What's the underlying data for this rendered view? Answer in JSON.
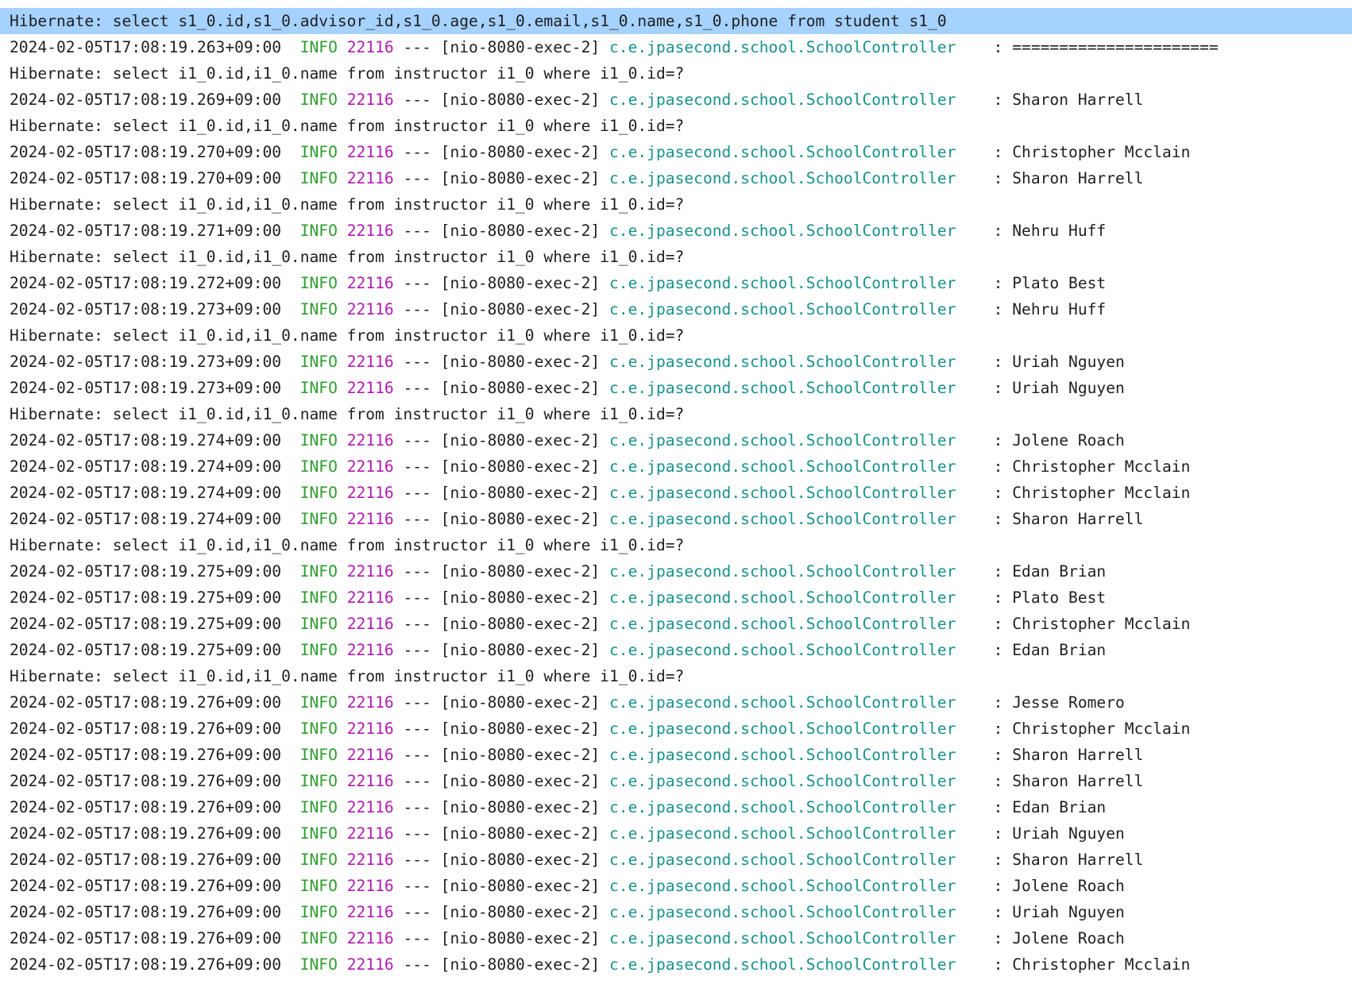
{
  "colors": {
    "selection": "#a6d2ff",
    "level_info": "#2e9e2e",
    "pid": "#b21ab2",
    "logger": "#17928a",
    "text": "#1f1f1f"
  },
  "log_lines": [
    {
      "type": "sql",
      "selected": true,
      "text": "Hibernate: select s1_0.id,s1_0.advisor_id,s1_0.age,s1_0.email,s1_0.name,s1_0.phone from student s1_0"
    },
    {
      "type": "log",
      "ts": "2024-02-05T17:08:19.263+09:00",
      "level": "INFO",
      "pid": "22116",
      "sep": "---",
      "thread": "[nio-8080-exec-2]",
      "logger": "c.e.jpasecond.school.SchoolController",
      "message": ": ======================"
    },
    {
      "type": "sql",
      "text": "Hibernate: select i1_0.id,i1_0.name from instructor i1_0 where i1_0.id=?"
    },
    {
      "type": "log",
      "ts": "2024-02-05T17:08:19.269+09:00",
      "level": "INFO",
      "pid": "22116",
      "sep": "---",
      "thread": "[nio-8080-exec-2]",
      "logger": "c.e.jpasecond.school.SchoolController",
      "message": ": Sharon Harrell"
    },
    {
      "type": "sql",
      "text": "Hibernate: select i1_0.id,i1_0.name from instructor i1_0 where i1_0.id=?"
    },
    {
      "type": "log",
      "ts": "2024-02-05T17:08:19.270+09:00",
      "level": "INFO",
      "pid": "22116",
      "sep": "---",
      "thread": "[nio-8080-exec-2]",
      "logger": "c.e.jpasecond.school.SchoolController",
      "message": ": Christopher Mcclain"
    },
    {
      "type": "log",
      "ts": "2024-02-05T17:08:19.270+09:00",
      "level": "INFO",
      "pid": "22116",
      "sep": "---",
      "thread": "[nio-8080-exec-2]",
      "logger": "c.e.jpasecond.school.SchoolController",
      "message": ": Sharon Harrell"
    },
    {
      "type": "sql",
      "text": "Hibernate: select i1_0.id,i1_0.name from instructor i1_0 where i1_0.id=?"
    },
    {
      "type": "log",
      "ts": "2024-02-05T17:08:19.271+09:00",
      "level": "INFO",
      "pid": "22116",
      "sep": "---",
      "thread": "[nio-8080-exec-2]",
      "logger": "c.e.jpasecond.school.SchoolController",
      "message": ": Nehru Huff"
    },
    {
      "type": "sql",
      "text": "Hibernate: select i1_0.id,i1_0.name from instructor i1_0 where i1_0.id=?"
    },
    {
      "type": "log",
      "ts": "2024-02-05T17:08:19.272+09:00",
      "level": "INFO",
      "pid": "22116",
      "sep": "---",
      "thread": "[nio-8080-exec-2]",
      "logger": "c.e.jpasecond.school.SchoolController",
      "message": ": Plato Best"
    },
    {
      "type": "log",
      "ts": "2024-02-05T17:08:19.273+09:00",
      "level": "INFO",
      "pid": "22116",
      "sep": "---",
      "thread": "[nio-8080-exec-2]",
      "logger": "c.e.jpasecond.school.SchoolController",
      "message": ": Nehru Huff"
    },
    {
      "type": "sql",
      "text": "Hibernate: select i1_0.id,i1_0.name from instructor i1_0 where i1_0.id=?"
    },
    {
      "type": "log",
      "ts": "2024-02-05T17:08:19.273+09:00",
      "level": "INFO",
      "pid": "22116",
      "sep": "---",
      "thread": "[nio-8080-exec-2]",
      "logger": "c.e.jpasecond.school.SchoolController",
      "message": ": Uriah Nguyen"
    },
    {
      "type": "log",
      "ts": "2024-02-05T17:08:19.273+09:00",
      "level": "INFO",
      "pid": "22116",
      "sep": "---",
      "thread": "[nio-8080-exec-2]",
      "logger": "c.e.jpasecond.school.SchoolController",
      "message": ": Uriah Nguyen"
    },
    {
      "type": "sql",
      "text": "Hibernate: select i1_0.id,i1_0.name from instructor i1_0 where i1_0.id=?"
    },
    {
      "type": "log",
      "ts": "2024-02-05T17:08:19.274+09:00",
      "level": "INFO",
      "pid": "22116",
      "sep": "---",
      "thread": "[nio-8080-exec-2]",
      "logger": "c.e.jpasecond.school.SchoolController",
      "message": ": Jolene Roach"
    },
    {
      "type": "log",
      "ts": "2024-02-05T17:08:19.274+09:00",
      "level": "INFO",
      "pid": "22116",
      "sep": "---",
      "thread": "[nio-8080-exec-2]",
      "logger": "c.e.jpasecond.school.SchoolController",
      "message": ": Christopher Mcclain"
    },
    {
      "type": "log",
      "ts": "2024-02-05T17:08:19.274+09:00",
      "level": "INFO",
      "pid": "22116",
      "sep": "---",
      "thread": "[nio-8080-exec-2]",
      "logger": "c.e.jpasecond.school.SchoolController",
      "message": ": Christopher Mcclain"
    },
    {
      "type": "log",
      "ts": "2024-02-05T17:08:19.274+09:00",
      "level": "INFO",
      "pid": "22116",
      "sep": "---",
      "thread": "[nio-8080-exec-2]",
      "logger": "c.e.jpasecond.school.SchoolController",
      "message": ": Sharon Harrell"
    },
    {
      "type": "sql",
      "text": "Hibernate: select i1_0.id,i1_0.name from instructor i1_0 where i1_0.id=?"
    },
    {
      "type": "log",
      "ts": "2024-02-05T17:08:19.275+09:00",
      "level": "INFO",
      "pid": "22116",
      "sep": "---",
      "thread": "[nio-8080-exec-2]",
      "logger": "c.e.jpasecond.school.SchoolController",
      "message": ": Edan Brian"
    },
    {
      "type": "log",
      "ts": "2024-02-05T17:08:19.275+09:00",
      "level": "INFO",
      "pid": "22116",
      "sep": "---",
      "thread": "[nio-8080-exec-2]",
      "logger": "c.e.jpasecond.school.SchoolController",
      "message": ": Plato Best"
    },
    {
      "type": "log",
      "ts": "2024-02-05T17:08:19.275+09:00",
      "level": "INFO",
      "pid": "22116",
      "sep": "---",
      "thread": "[nio-8080-exec-2]",
      "logger": "c.e.jpasecond.school.SchoolController",
      "message": ": Christopher Mcclain"
    },
    {
      "type": "log",
      "ts": "2024-02-05T17:08:19.275+09:00",
      "level": "INFO",
      "pid": "22116",
      "sep": "---",
      "thread": "[nio-8080-exec-2]",
      "logger": "c.e.jpasecond.school.SchoolController",
      "message": ": Edan Brian"
    },
    {
      "type": "sql",
      "text": "Hibernate: select i1_0.id,i1_0.name from instructor i1_0 where i1_0.id=?"
    },
    {
      "type": "log",
      "ts": "2024-02-05T17:08:19.276+09:00",
      "level": "INFO",
      "pid": "22116",
      "sep": "---",
      "thread": "[nio-8080-exec-2]",
      "logger": "c.e.jpasecond.school.SchoolController",
      "message": ": Jesse Romero"
    },
    {
      "type": "log",
      "ts": "2024-02-05T17:08:19.276+09:00",
      "level": "INFO",
      "pid": "22116",
      "sep": "---",
      "thread": "[nio-8080-exec-2]",
      "logger": "c.e.jpasecond.school.SchoolController",
      "message": ": Christopher Mcclain"
    },
    {
      "type": "log",
      "ts": "2024-02-05T17:08:19.276+09:00",
      "level": "INFO",
      "pid": "22116",
      "sep": "---",
      "thread": "[nio-8080-exec-2]",
      "logger": "c.e.jpasecond.school.SchoolController",
      "message": ": Sharon Harrell"
    },
    {
      "type": "log",
      "ts": "2024-02-05T17:08:19.276+09:00",
      "level": "INFO",
      "pid": "22116",
      "sep": "---",
      "thread": "[nio-8080-exec-2]",
      "logger": "c.e.jpasecond.school.SchoolController",
      "message": ": Sharon Harrell"
    },
    {
      "type": "log",
      "ts": "2024-02-05T17:08:19.276+09:00",
      "level": "INFO",
      "pid": "22116",
      "sep": "---",
      "thread": "[nio-8080-exec-2]",
      "logger": "c.e.jpasecond.school.SchoolController",
      "message": ": Edan Brian"
    },
    {
      "type": "log",
      "ts": "2024-02-05T17:08:19.276+09:00",
      "level": "INFO",
      "pid": "22116",
      "sep": "---",
      "thread": "[nio-8080-exec-2]",
      "logger": "c.e.jpasecond.school.SchoolController",
      "message": ": Uriah Nguyen"
    },
    {
      "type": "log",
      "ts": "2024-02-05T17:08:19.276+09:00",
      "level": "INFO",
      "pid": "22116",
      "sep": "---",
      "thread": "[nio-8080-exec-2]",
      "logger": "c.e.jpasecond.school.SchoolController",
      "message": ": Sharon Harrell"
    },
    {
      "type": "log",
      "ts": "2024-02-05T17:08:19.276+09:00",
      "level": "INFO",
      "pid": "22116",
      "sep": "---",
      "thread": "[nio-8080-exec-2]",
      "logger": "c.e.jpasecond.school.SchoolController",
      "message": ": Jolene Roach"
    },
    {
      "type": "log",
      "ts": "2024-02-05T17:08:19.276+09:00",
      "level": "INFO",
      "pid": "22116",
      "sep": "---",
      "thread": "[nio-8080-exec-2]",
      "logger": "c.e.jpasecond.school.SchoolController",
      "message": ": Uriah Nguyen"
    },
    {
      "type": "log",
      "ts": "2024-02-05T17:08:19.276+09:00",
      "level": "INFO",
      "pid": "22116",
      "sep": "---",
      "thread": "[nio-8080-exec-2]",
      "logger": "c.e.jpasecond.school.SchoolController",
      "message": ": Jolene Roach"
    },
    {
      "type": "log",
      "ts": "2024-02-05T17:08:19.276+09:00",
      "level": "INFO",
      "pid": "22116",
      "sep": "---",
      "thread": "[nio-8080-exec-2]",
      "logger": "c.e.jpasecond.school.SchoolController",
      "message": ": Christopher Mcclain"
    }
  ]
}
